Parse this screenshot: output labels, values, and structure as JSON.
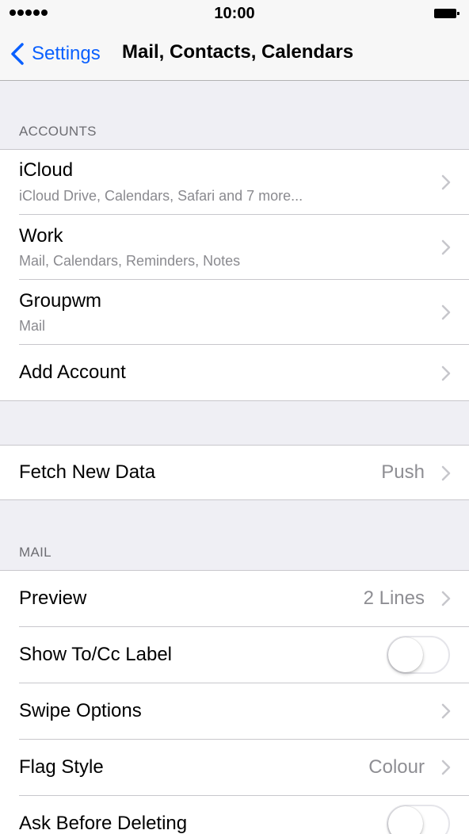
{
  "status_bar": {
    "time": "10:00",
    "signal_icon": "signal-dots-icon",
    "battery_icon": "battery-icon"
  },
  "nav": {
    "back_label": "Settings",
    "back_icon": "chevron-left-icon",
    "title": "Mail, Contacts, Calendars"
  },
  "accounts": {
    "header": "ACCOUNTS",
    "items": [
      {
        "title": "iCloud",
        "subtitle": "iCloud Drive, Calendars, Safari and 7 more..."
      },
      {
        "title": "Work",
        "subtitle": "Mail, Calendars, Reminders, Notes"
      },
      {
        "title": "Groupwm",
        "subtitle": "Mail"
      },
      {
        "title": "Add Account"
      }
    ]
  },
  "fetch": {
    "title": "Fetch New Data",
    "value": "Push"
  },
  "mail": {
    "header": "MAIL",
    "items": [
      {
        "title": "Preview",
        "value": "2 Lines"
      },
      {
        "title": "Show To/Cc Label",
        "toggle": false
      },
      {
        "title": "Swipe Options"
      },
      {
        "title": "Flag Style",
        "value": "Colour"
      },
      {
        "title": "Ask Before Deleting",
        "toggle": false
      }
    ]
  },
  "colors": {
    "accent": "#0a60ff",
    "background": "#efeff4",
    "secondary_text": "#8e8e93"
  }
}
